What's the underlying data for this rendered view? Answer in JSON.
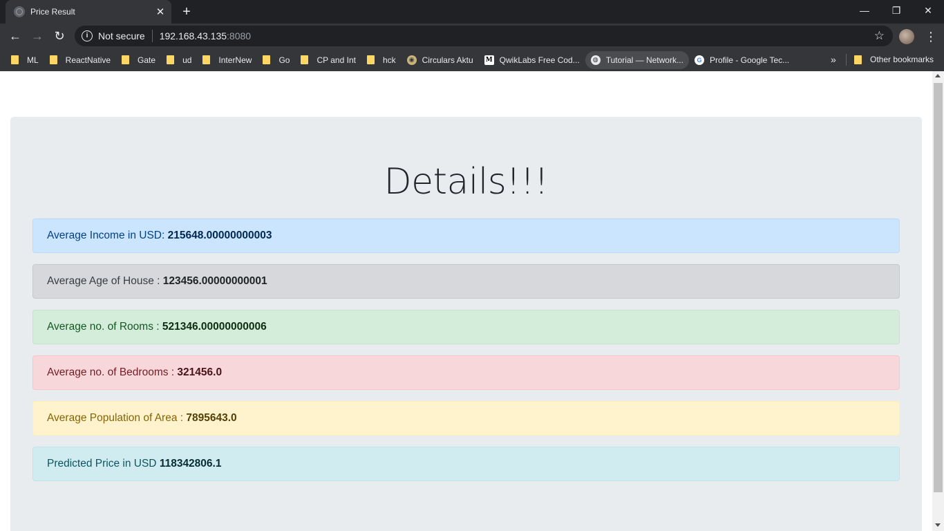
{
  "browser": {
    "tab_title": "Price Result",
    "tab_close": "✕",
    "new_tab": "+",
    "window_controls": {
      "minimize": "—",
      "restore": "❐",
      "close": "✕"
    },
    "nav": {
      "back": "←",
      "forward": "→",
      "reload": "↻"
    },
    "address": {
      "security_label": "Not secure",
      "host": "192.168.43.135",
      "port": ":8080",
      "star": "☆"
    },
    "menu": "⋮",
    "bookmarks": [
      {
        "label": "ML",
        "icon": "folder-icon"
      },
      {
        "label": "ReactNative",
        "icon": "folder-icon"
      },
      {
        "label": "Gate",
        "icon": "folder-icon"
      },
      {
        "label": "ud",
        "icon": "folder-icon"
      },
      {
        "label": "InterNew",
        "icon": "folder-icon"
      },
      {
        "label": "Go",
        "icon": "folder-icon"
      },
      {
        "label": "CP and Int",
        "icon": "folder-icon"
      },
      {
        "label": "hck",
        "icon": "folder-icon"
      },
      {
        "label": "Circulars Aktu",
        "icon": "site-icon"
      },
      {
        "label": "QwikLabs Free Cod...",
        "icon": "medium-icon"
      },
      {
        "label": "Tutorial — Network...",
        "icon": "globe-icon"
      },
      {
        "label": "Profile - Google Tec...",
        "icon": "google-icon"
      }
    ],
    "bookmarks_more": "»",
    "other_bookmarks": "Other bookmarks"
  },
  "page": {
    "heading": "Details!!!",
    "details": [
      {
        "label": "Average Income in USD: ",
        "value": "215648.00000000003",
        "style": "primary"
      },
      {
        "label": "Average Age of House : ",
        "value": "123456.00000000001",
        "style": "secondary"
      },
      {
        "label": "Average no. of Rooms : ",
        "value": "521346.00000000006",
        "style": "success"
      },
      {
        "label": "Average no. of Bedrooms : ",
        "value": "321456.0",
        "style": "danger"
      },
      {
        "label": "Average Population of Area : ",
        "value": "7895643.0",
        "style": "warning"
      },
      {
        "label": "Predicted Price in USD ",
        "value": "118342806.1",
        "style": "info"
      }
    ]
  }
}
